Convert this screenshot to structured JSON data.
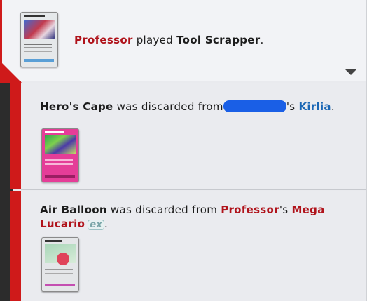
{
  "log": {
    "entries": [
      {
        "actor": "Professor",
        "verb": " played ",
        "card_name": "Tool Scrapper",
        "end": "."
      },
      {
        "card_name": "Hero's Cape",
        "text": " was discarded from",
        "possessive": "'s ",
        "pokemon": "Kirlia",
        "end": "."
      },
      {
        "card_name": "Air Balloon",
        "text": " was discarded from ",
        "owner": "Professor",
        "possessive": "'s ",
        "pokemon": "Mega Lucario",
        "badge": "ex",
        "end": "."
      }
    ]
  },
  "icons": {
    "collapse": "chevron-down-icon",
    "ex_badge": "ex-badge-icon"
  },
  "colors": {
    "accent_red": "#cf1a1a",
    "player_name": "#b0131b",
    "opponent_pokemon": "#1b67b5",
    "redaction": "#1a5fe6"
  }
}
